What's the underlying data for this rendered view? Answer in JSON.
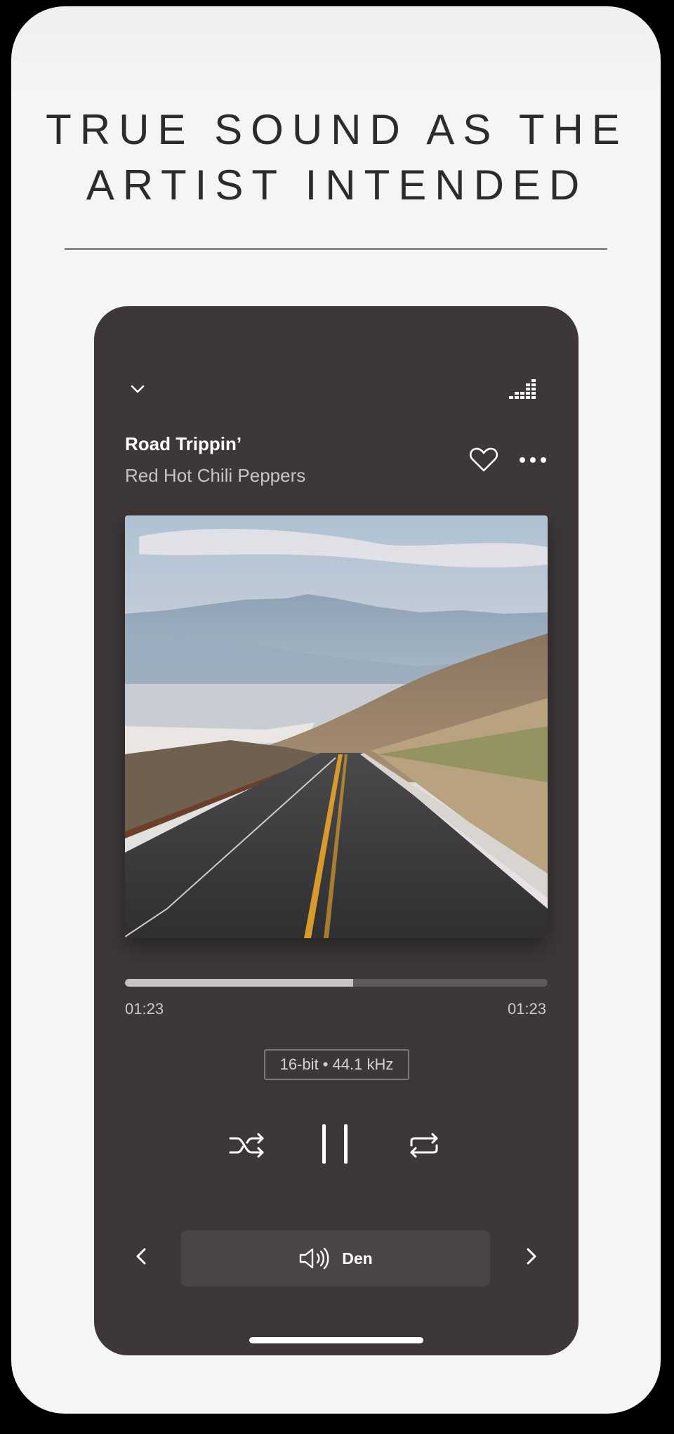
{
  "headline": {
    "line1": "TRUE SOUND AS THE",
    "line2": "ARTIST INTENDED"
  },
  "player": {
    "track_title": "Road Trippin’",
    "artist": "Red Hot Chili Peppers",
    "elapsed": "01:23",
    "remaining": "01:23",
    "progress_fraction": 0.54,
    "quality_badge": "16-bit • 44.1 kHz",
    "device_name": "Den",
    "is_playing": true,
    "album_art": "desert-road-with-mountains"
  },
  "icons": {
    "collapse": "chevron-down-icon",
    "equalizer": "equalizer-icon",
    "favorite": "heart-icon",
    "more": "more-options-icon",
    "shuffle": "shuffle-icon",
    "pause": "pause-icon",
    "repeat": "repeat-icon",
    "previous_device": "chevron-left-icon",
    "next_device": "chevron-right-icon",
    "speaker": "speaker-icon"
  },
  "colors": {
    "page_background": "#f5f5f5",
    "player_background": "#3d3737",
    "text_primary": "#ffffff",
    "text_secondary": "#c9c4c4",
    "progress_fill": "#c8c3c3",
    "progress_track": "#5e5858"
  }
}
